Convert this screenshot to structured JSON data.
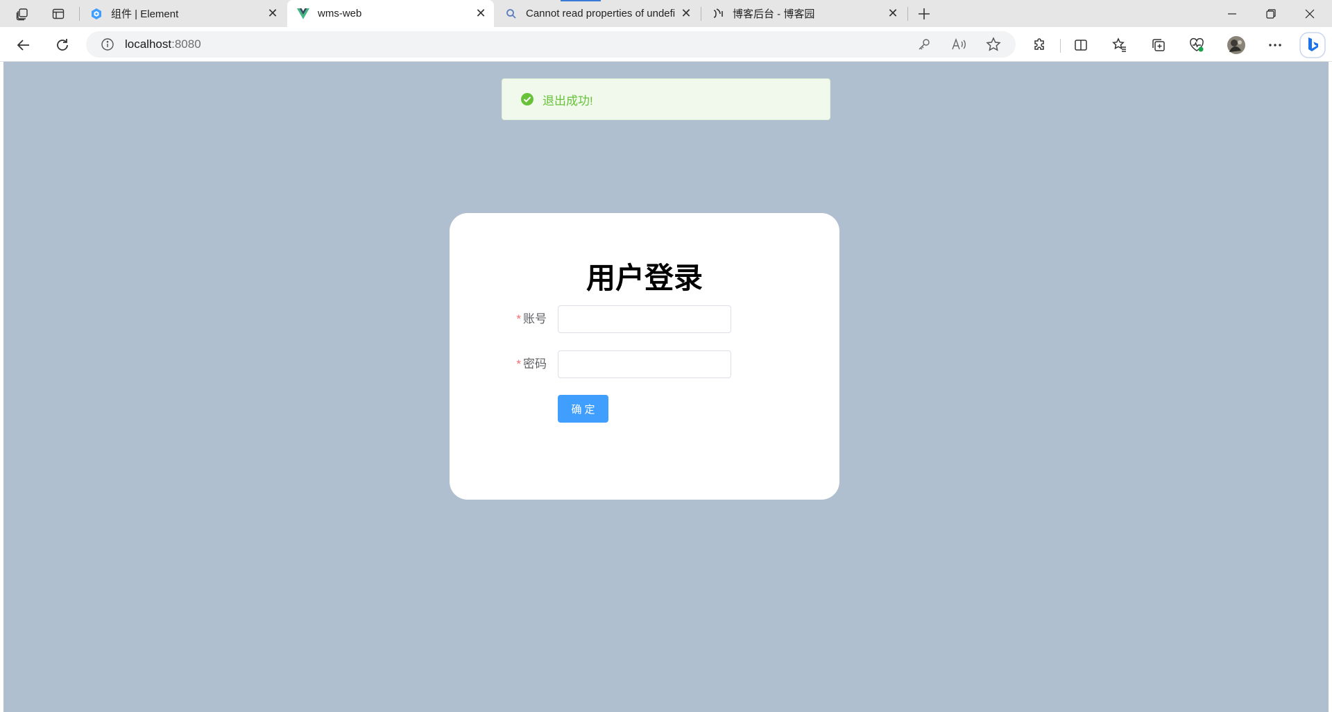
{
  "tabs": [
    {
      "title": "组件 | Element",
      "favicon": "element-ui-icon",
      "active": false
    },
    {
      "title": "wms-web",
      "favicon": "vue-icon",
      "active": true
    },
    {
      "title": "Cannot read properties of undefi",
      "favicon": "search-icon",
      "active": false
    },
    {
      "title": "博客后台 - 博客园",
      "favicon": "cnblogs-icon",
      "active": false
    }
  ],
  "address": {
    "host": "localhost",
    "port": ":8080"
  },
  "toast": {
    "message": "退出成功!",
    "type": "success"
  },
  "login": {
    "title": "用户登录",
    "required_mark": "*",
    "account_label": "账号",
    "account_value": "",
    "password_label": "密码",
    "password_value": "",
    "submit_label": "确定"
  },
  "colors": {
    "page_bg": "#b0bfd0",
    "primary": "#409eff",
    "success": "#67c23a",
    "required": "#f56c6c"
  }
}
